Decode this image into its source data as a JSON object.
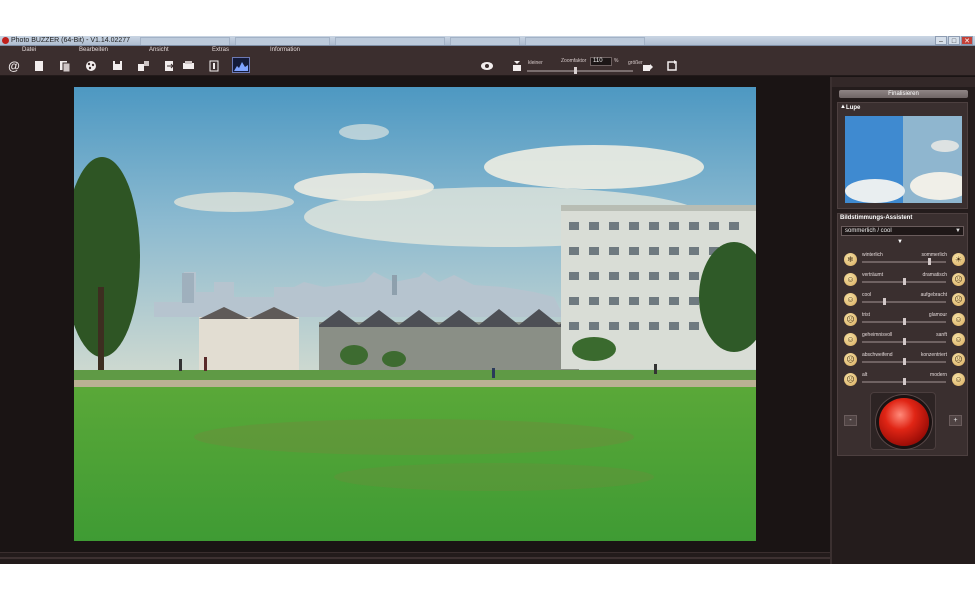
{
  "window": {
    "title": "Photo BUZZER (64-Bit) - V1.14.02277",
    "controls": [
      "–",
      "□",
      "✕"
    ]
  },
  "menu": [
    "Datei",
    "Bearbeiten",
    "Ansicht",
    "Extras",
    "Information"
  ],
  "toolbar": {
    "icons": [
      "at-icon",
      "new-document-icon",
      "copy-document-icon",
      "palette-icon",
      "save-icon",
      "batch-icon",
      "export-icon",
      "print-icon",
      "info-icon",
      "histogram-icon",
      "eye-icon",
      "zoom-out-icon",
      "zoom-in-icon",
      "rotate-icon"
    ]
  },
  "zoom": {
    "smaller_label": "kleiner",
    "factor_label": "Zoomfaktor",
    "value": "110",
    "unit": "%",
    "larger_label": "größer"
  },
  "right_panel": {
    "finalize_label": "Finalisieren",
    "lupe_label": "Lupe",
    "mood_title": "Bildstimmungs-Assistent",
    "mood_selected": "sommerlich / cool",
    "sliders": [
      {
        "left": "winterlich",
        "right": "sommerlich",
        "value": 0.82,
        "left_icon": "snowflake-icon",
        "right_icon": "sun-icon"
      },
      {
        "left": "verträumt",
        "right": "dramatisch",
        "value": 0.5,
        "left_icon": "dreamy-face-icon",
        "right_icon": "dramatic-face-icon"
      },
      {
        "left": "cool",
        "right": "aufgebracht",
        "value": 0.26,
        "left_icon": "cool-face-icon",
        "right_icon": "angry-face-icon"
      },
      {
        "left": "trist",
        "right": "glamour",
        "value": 0.5,
        "left_icon": "sad-face-icon",
        "right_icon": "glamour-face-icon"
      },
      {
        "left": "geheimnisvoll",
        "right": "sanft",
        "value": 0.5,
        "left_icon": "mysterious-face-icon",
        "right_icon": "gentle-face-icon"
      },
      {
        "left": "abschweifend",
        "right": "konzentriert",
        "value": 0.5,
        "left_icon": "distracted-face-icon",
        "right_icon": "focused-face-icon"
      },
      {
        "left": "alt",
        "right": "modern",
        "value": 0.5,
        "left_icon": "old-face-icon",
        "right_icon": "modern-face-icon"
      }
    ],
    "minus_label": "-",
    "plus_label": "+"
  },
  "colors": {
    "app_background": "#1a1414",
    "toolbar": "#3b2e2e",
    "panel": "#3a2f2f",
    "buzzer": "#e02515"
  }
}
